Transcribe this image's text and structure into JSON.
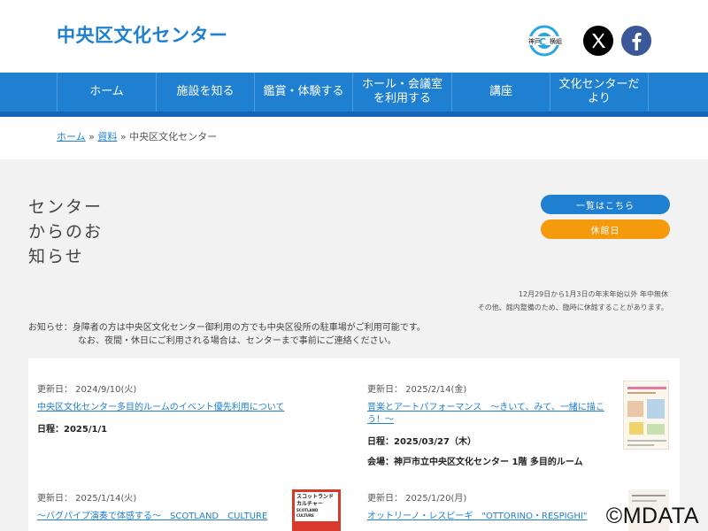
{
  "header": {
    "site_title": "中央区文化センター",
    "kobe_logo_text": "神戸",
    "kobe_logo_text2": "横組"
  },
  "nav": {
    "items": [
      {
        "label": "ホーム"
      },
      {
        "label": "施設を知る"
      },
      {
        "label": "鑑賞・体験する"
      },
      {
        "label": "ホール・会議室を利用する"
      },
      {
        "label": "講座"
      },
      {
        "label": "文化センターだより"
      }
    ]
  },
  "breadcrumb": {
    "home": "ホーム",
    "sep1": " » ",
    "archive": "資料",
    "sep2": " » ",
    "current": "中央区文化センター"
  },
  "section": {
    "title": "センターからのお知らせ",
    "list_button": "一覧はこちら",
    "closed_button": "休館日"
  },
  "closed_note": {
    "line1": "12月29日から1月3日の年末年始以外 年中無休",
    "line2": "その他、館内整備のため、臨時に休館することがあります。"
  },
  "notice": {
    "line1": "お知らせ：身障者の方は中央区文化センター御利用の方でも中央区役所の駐車場がご利用可能です。",
    "line2": "なお、夜間・休日にご利用される場合は、センターまで事前にご連絡ください。"
  },
  "cards": [
    {
      "date": "更新日： 2024/9/10(火)",
      "title": "中央区文化センター多目的ルームのイベント優先利用について",
      "info": "日程：2025/1/1"
    },
    {
      "date": "更新日： 2025/2/14(金)",
      "title": "音楽とアートパフォーマンス　～きいて、みて、一緒に描こう！～",
      "info": "日程：2025/03/27（木）",
      "info2": "会場：神戸市立中央区文化センター 1階 多目的ルーム"
    },
    {
      "date": "更新日： 2025/1/14(火)",
      "title": "～バグパイプ演奏で体感する～　SCOTLAND　CULTURE"
    },
    {
      "date": "更新日： 2025/1/20(月)",
      "title": "オットリーノ・レスピーギ　\"OTTORINO・RESPIGHI\""
    }
  ],
  "thumb_b": {
    "line1": "スコットランド",
    "line2": "カルチャー",
    "line3": "SCOTLAND CULTURE"
  },
  "watermark": "©MDATA",
  "colors": {
    "brand_blue": "#1f7fd0",
    "orange": "#f59a0c",
    "facebook": "#3b5998"
  }
}
